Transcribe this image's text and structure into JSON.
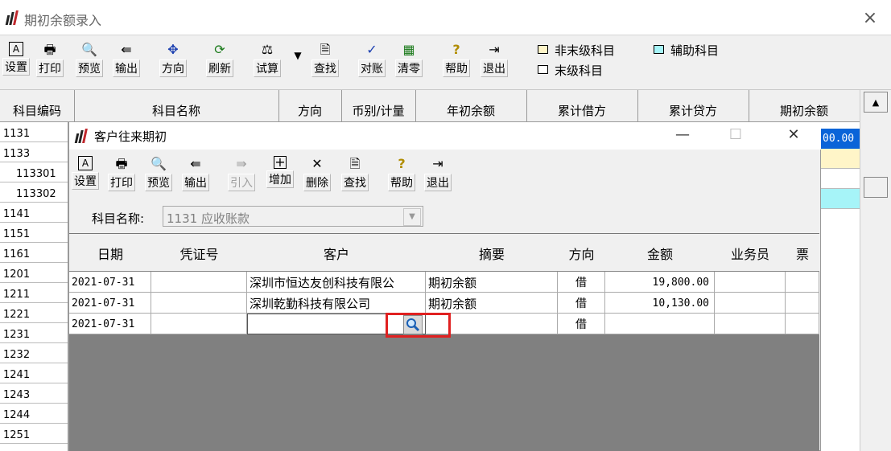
{
  "outer": {
    "title": "期初余额录入",
    "close": "×",
    "toolbar": [
      {
        "label": "设置",
        "icon": "A"
      },
      {
        "label": "打印",
        "icon": "🖶"
      },
      {
        "label": "预览",
        "icon": "🔍"
      },
      {
        "label": "输出",
        "icon": "⇚"
      },
      {
        "label": "方向",
        "icon": "✥"
      },
      {
        "label": "刷新",
        "icon": "⟳"
      },
      {
        "label": "试算",
        "icon": "⚖"
      },
      {
        "label": "查找",
        "icon": "🗎"
      },
      {
        "label": "对账",
        "icon": "✓"
      },
      {
        "label": "清零",
        "icon": "▦"
      },
      {
        "label": "帮助",
        "icon": "?"
      },
      {
        "label": "退出",
        "icon": "⇥"
      }
    ],
    "legend": {
      "non_leaf": "非末级科目",
      "auxiliary": "辅助科目",
      "leaf": "末级科目"
    },
    "columns": [
      "科目编码",
      "科目名称",
      "方向",
      "币别/计量",
      "年初余额",
      "累计借方",
      "累计贷方",
      "期初余额"
    ],
    "codes": [
      "1131",
      "1133",
      "113301",
      "113302",
      "1141",
      "1151",
      "1161",
      "1201",
      "1211",
      "1221",
      "1231",
      "1232",
      "1241",
      "1243",
      "1244",
      "1251"
    ],
    "right_value": "00.00",
    "colors": {
      "yellow": "#fff5c8",
      "cyan": "#a6f4f8",
      "blue": "#0a64d8"
    }
  },
  "dialog": {
    "title": "客户往来期初",
    "min": "—",
    "max": "☐",
    "close": "✕",
    "toolbar": [
      {
        "label": "设置",
        "icon": "A",
        "enabled": true
      },
      {
        "label": "打印",
        "icon": "🖶",
        "enabled": true
      },
      {
        "label": "预览",
        "icon": "🔍",
        "enabled": true
      },
      {
        "label": "输出",
        "icon": "⇚",
        "enabled": true
      },
      {
        "label": "引入",
        "icon": "⇛",
        "enabled": false
      },
      {
        "label": "增加",
        "icon": "+",
        "enabled": true
      },
      {
        "label": "删除",
        "icon": "✕",
        "enabled": true
      },
      {
        "label": "查找",
        "icon": "🗎",
        "enabled": true
      },
      {
        "label": "帮助",
        "icon": "?",
        "enabled": true
      },
      {
        "label": "退出",
        "icon": "⇥",
        "enabled": true
      }
    ],
    "subject_label": "科目名称:",
    "subject_value": "1131 应收账款",
    "columns": [
      "日期",
      "凭证号",
      "客户",
      "摘要",
      "方向",
      "金额",
      "业务员",
      "票"
    ],
    "rows": [
      {
        "date": "2021-07-31",
        "voucher": "",
        "customer": "深圳市恒达友创科技有限公",
        "summary": "期初余额",
        "direction": "借",
        "amount": "19,800.00"
      },
      {
        "date": "2021-07-31",
        "voucher": "",
        "customer": "深圳乾勤科技有限公司",
        "summary": "期初余额",
        "direction": "借",
        "amount": "10,130.00"
      },
      {
        "date": "2021-07-31",
        "voucher": "",
        "customer": "",
        "summary": "",
        "direction": "借",
        "amount": ""
      }
    ]
  }
}
